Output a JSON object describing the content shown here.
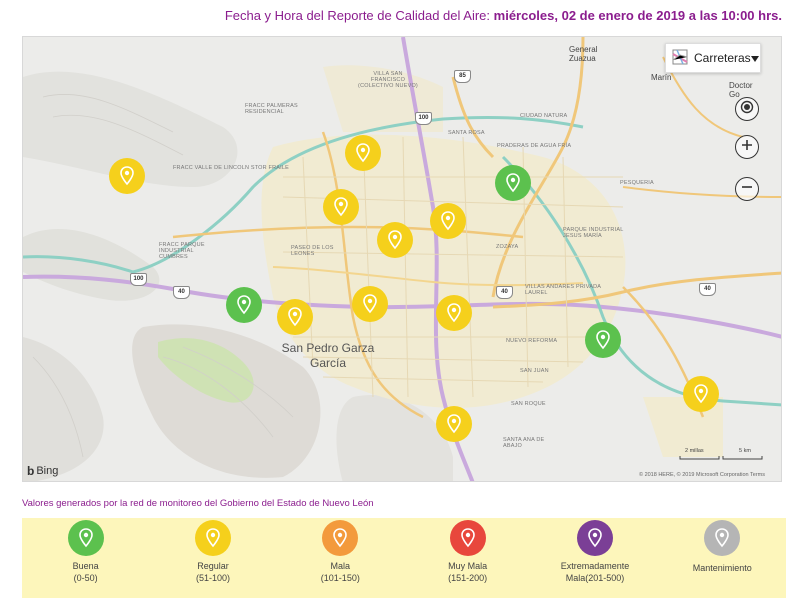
{
  "header": {
    "prefix": "Fecha y Hora del Reporte de Calidad del Aire:",
    "datetime": "miércoles, 02 de enero de 2019 a las 10:00 hrs."
  },
  "map": {
    "map_type_label": "Carreteras",
    "icons": {
      "map_type": "road-map-icon",
      "locate": "locate-icon",
      "zoom_in": "zoom-in-icon",
      "zoom_out": "zoom-out-icon",
      "dropdown": "caret-down-icon"
    },
    "places": {
      "villa_san_francisco": "VILLA SAN FRANCISCO (COLECTIVO NUEVO)",
      "fracc_palmeras": "FRACC PALMERAS RESIDENCIAL",
      "santa_rosa": "SANTA ROSA",
      "ciudad_natura": "CIUDAD NATURA",
      "fracc_valle_lincoln": "FRACC VALLE DE LINCOLN STOR FRAILE",
      "praderas_agua_fria": "PRADERAS DE AGUA FRÍA",
      "pesqueria": "PESQUERIA",
      "parque_industrial_jesus_maria": "PARQUE INDUSTRIAL JESUS MARÍA",
      "fracc_parque_industrial_cumbres": "FRACC PARQUE INDUSTRIAL CUMBRES",
      "paseo_de_los_leones": "PASEO DE LOS LEONES",
      "zozaya": "ZOZAYA",
      "villas_andares": "VILLAS ANDARES PRIVADA LAUREL",
      "nuevo_reforma": "NUEVO REFORMA",
      "san_juan": "SAN JUAN",
      "san_roque": "SAN ROQUE",
      "santa_ana_de_abajo": "SANTA ANA DE ABAJO",
      "general_zuazua": "General Zuazua",
      "marin": "Marín",
      "doctor_go": "Doctor Go"
    },
    "city_label": "San Pedro Garza García",
    "shields": [
      "85",
      "100",
      "100",
      "40",
      "40",
      "40"
    ],
    "bing": "Bing",
    "scale": {
      "miles": "2 millas",
      "km": "5 km"
    },
    "copyright": "© 2018 HERE, © 2019 Microsoft Corporation Terms",
    "stations": [
      {
        "status": "regular"
      },
      {
        "status": "regular"
      },
      {
        "status": "regular"
      },
      {
        "status": "regular"
      },
      {
        "status": "regular"
      },
      {
        "status": "buena"
      },
      {
        "status": "buena"
      },
      {
        "status": "regular"
      },
      {
        "status": "regular"
      },
      {
        "status": "regular"
      },
      {
        "status": "buena"
      },
      {
        "status": "regular"
      },
      {
        "status": "regular"
      }
    ]
  },
  "legend": {
    "caption": "Valores generados por la red de monitoreo del Gobierno del Estado de Nuevo León",
    "items": [
      {
        "line1": "Buena",
        "line2": "(0-50)",
        "color": "#5cc14e"
      },
      {
        "line1": "Regular",
        "line2": "(51-100)",
        "color": "#f5d01c"
      },
      {
        "line1": "Mala",
        "line2": "(101-150)",
        "color": "#f39a3c"
      },
      {
        "line1": "Muy Mala",
        "line2": "(151-200)",
        "color": "#e8473c"
      },
      {
        "line1": "Extremadamente",
        "line2": "Mala(201-500)",
        "color": "#7b3f96"
      },
      {
        "line1": "Mantenimiento",
        "line2": "",
        "color": "#b5b5b5"
      }
    ]
  },
  "colors": {
    "buena": "#5cc14e",
    "regular": "#f5d01c",
    "header": "#8b1d8e"
  }
}
